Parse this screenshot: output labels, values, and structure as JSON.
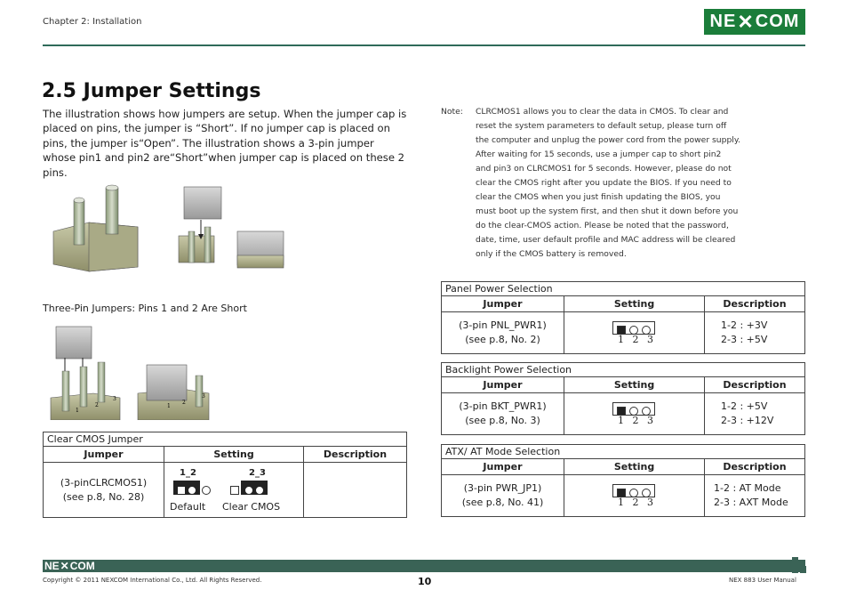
{
  "header": {
    "chapter": "Chapter 2: Installation",
    "logo": "NE COM"
  },
  "section": {
    "title": "2.5 Jumper Settings"
  },
  "intro": "The illustration shows how jumpers are setup. When the jumper cap is placed on pins, the jumper is “Short”. If no jumper cap is placed on pins, the jumper is“Open”. The illustration shows a 3-pin jumper whose pin1 and pin2 are“Short”when jumper cap is placed on these 2 pins.",
  "note": {
    "label": "Note:",
    "lines": [
      "CLRCMOS1 allows you to clear the data in CMOS. To clear and",
      "reset the system parameters to default setup, please turn off",
      "the computer and unplug the power cord from the power supply.",
      "After waiting for 15 seconds, use a jumper cap to short pin2",
      "and pin3 on CLRCMOS1 for 5 seconds. However, please do not",
      "clear the CMOS right after you update the BIOS. If you need to",
      "clear the CMOS when you just finish updating the BIOS, you",
      "must boot up the system first, and then shut it down before you",
      "do the clear-CMOS action. Please be noted that the password,",
      "date, time, user default profile and MAC address will be cleared",
      "only if the CMOS battery is removed."
    ]
  },
  "caption": "Three-Pin Jumpers: Pins 1 and 2 Are Short",
  "illustration": {
    "pin1": "1",
    "pin2": "2",
    "pin3": "3"
  },
  "headers": {
    "jumper": "Jumper",
    "setting": "Setting",
    "description": "Description"
  },
  "clear_cmos": {
    "caption": "Clear CMOS Jumper",
    "jumper_line1": "(3-pinCLRCMOS1)",
    "jumper_line2": "(see p.8,  No. 28)",
    "label_12": "1_2",
    "label_23": "2_3",
    "default_label": "Default",
    "clear_label": "Clear CMOS"
  },
  "pin_numbers": "1 2 3",
  "panel_power": {
    "caption": "Panel Power Selection",
    "jumper_line1": "(3-pin PNL_PWR1)",
    "jumper_line2": "(see p.8,  No. 2)",
    "desc1": "1-2 : +3V",
    "desc2": "2-3 : +5V"
  },
  "backlight_power": {
    "caption": "Backlight Power Selection",
    "jumper_line1": "(3-pin BKT_PWR1)",
    "jumper_line2": "(see p.8,  No. 3)",
    "desc1": "1-2 : +5V",
    "desc2": "2-3 : +12V"
  },
  "atx_mode": {
    "caption": "ATX/ AT Mode Selection",
    "jumper_line1": "(3-pin PWR_JP1)",
    "jumper_line2": "(see p.8,  No. 41)",
    "desc1": "1-2 : AT Mode",
    "desc2": "2-3 : AXT Mode"
  },
  "footer": {
    "logo": "NE COM",
    "copyright": "Copyright © 2011 NEXCOM International Co., Ltd. All Rights Reserved.",
    "page": "10",
    "manual": "NEX 883 User Manual"
  },
  "colors": {
    "brand_green": "#1b7d3a",
    "rule": "#2f6b5a",
    "footer_bar": "#3a6356"
  }
}
